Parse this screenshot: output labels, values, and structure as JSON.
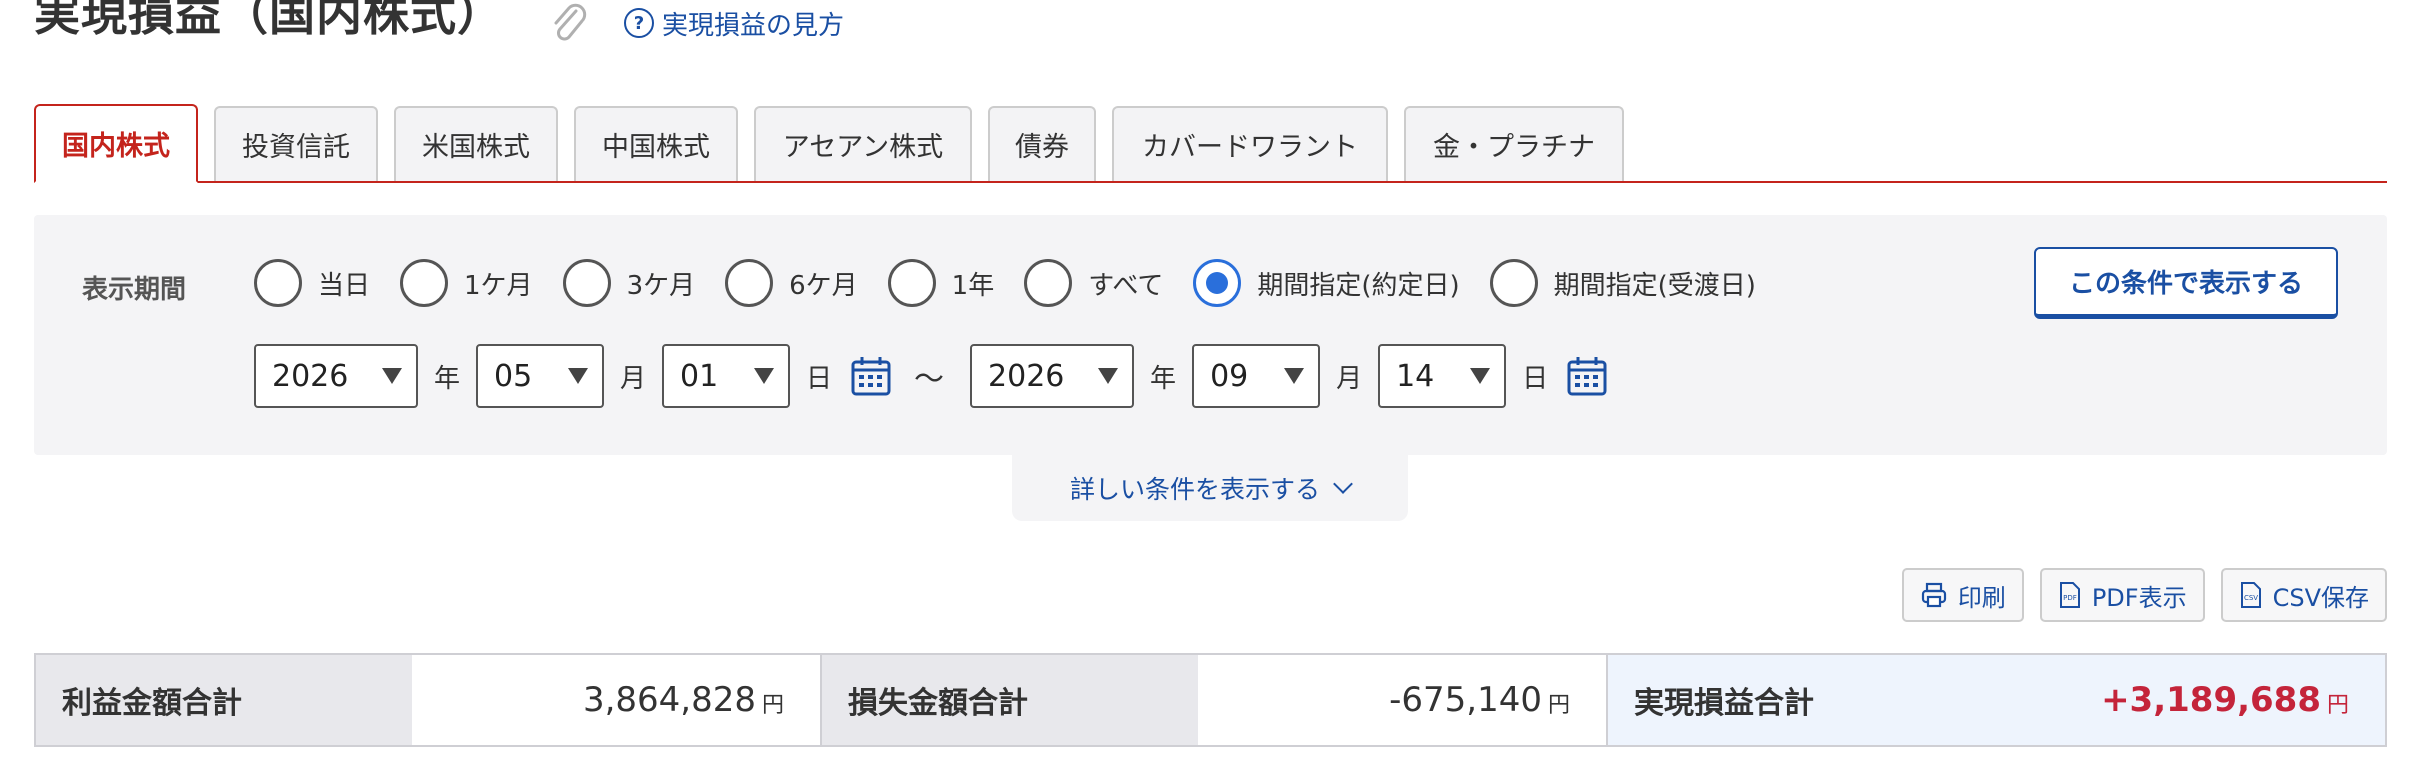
{
  "header": {
    "title": "実現損益（国内株式）",
    "help_link": "実現損益の見方",
    "help_icon": "question-circle-icon",
    "clip_icon": "paperclip-icon"
  },
  "tabs": [
    {
      "label": "国内株式",
      "active": true
    },
    {
      "label": "投資信託",
      "active": false
    },
    {
      "label": "米国株式",
      "active": false
    },
    {
      "label": "中国株式",
      "active": false
    },
    {
      "label": "アセアン株式",
      "active": false
    },
    {
      "label": "債券",
      "active": false
    },
    {
      "label": "カバードワラント",
      "active": false
    },
    {
      "label": "金・プラチナ",
      "active": false
    }
  ],
  "filter": {
    "period_label": "表示期間",
    "options": [
      {
        "label": "当日",
        "checked": false
      },
      {
        "label": "1ケ月",
        "checked": false
      },
      {
        "label": "3ケ月",
        "checked": false
      },
      {
        "label": "6ケ月",
        "checked": false
      },
      {
        "label": "1年",
        "checked": false
      },
      {
        "label": "すべて",
        "checked": false
      },
      {
        "label": "期間指定(約定日)",
        "checked": true
      },
      {
        "label": "期間指定(受渡日)",
        "checked": false
      }
    ],
    "show_button": "この条件で表示する",
    "from": {
      "year": "2026",
      "month": "05",
      "day": "01"
    },
    "to": {
      "year": "2026",
      "month": "09",
      "day": "14"
    },
    "unit_year": "年",
    "unit_month": "月",
    "unit_day": "日",
    "tilde": "～",
    "more_conditions": "詳しい条件を表示する"
  },
  "actions": {
    "print": "印刷",
    "pdf": "PDF表示",
    "csv": "CSV保存"
  },
  "summary": {
    "profit_label": "利益金額合計",
    "profit_value": "3,864,828",
    "loss_label": "損失金額合計",
    "loss_value": "-675,140",
    "total_label": "実現損益合計",
    "total_value": "+3,189,688",
    "yen": "円"
  },
  "colors": {
    "accent_red": "#c4241c",
    "link_blue": "#1a4fa3",
    "radio_blue": "#2a6fdb",
    "profit_red": "#c4243a"
  }
}
